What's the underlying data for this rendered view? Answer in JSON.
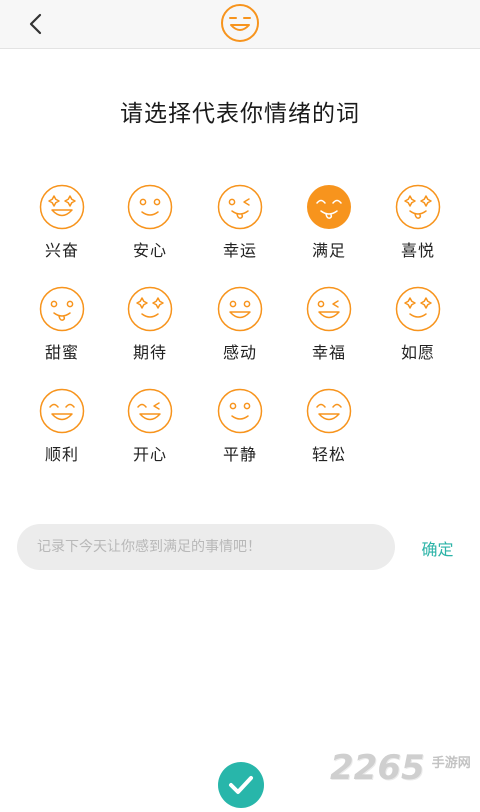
{
  "header": {
    "back_icon": "chevron-left-icon",
    "face_icon": "smile-face-icon"
  },
  "title": "请选择代表你情绪的词",
  "moods": [
    {
      "label": "兴奋",
      "icon": "star-eyes-face-icon",
      "selected": false
    },
    {
      "label": "安心",
      "icon": "calm-smile-face-icon",
      "selected": false
    },
    {
      "label": "幸运",
      "icon": "wink-tongue-face-icon",
      "selected": false
    },
    {
      "label": "满足",
      "icon": "content-tongue-face-icon",
      "selected": true
    },
    {
      "label": "喜悦",
      "icon": "star-eyes-tongue-face-icon",
      "selected": false
    },
    {
      "label": "甜蜜",
      "icon": "sweet-tongue-face-icon",
      "selected": false
    },
    {
      "label": "期待",
      "icon": "star-eyes-grin-face-icon",
      "selected": false
    },
    {
      "label": "感动",
      "icon": "moved-grin-face-icon",
      "selected": false
    },
    {
      "label": "幸福",
      "icon": "wink-grin-face-icon",
      "selected": false
    },
    {
      "label": "如愿",
      "icon": "star-eyes-smile-face-icon",
      "selected": false
    },
    {
      "label": "顺利",
      "icon": "happy-eyes-grin-face-icon",
      "selected": false
    },
    {
      "label": "开心",
      "icon": "wink-laugh-face-icon",
      "selected": false
    },
    {
      "label": "平静",
      "icon": "peaceful-smile-face-icon",
      "selected": false
    },
    {
      "label": "轻松",
      "icon": "relaxed-grin-face-icon",
      "selected": false
    }
  ],
  "note": {
    "value": "",
    "placeholder": "记录下今天让你感到满足的事情吧！"
  },
  "confirm_label": "确定",
  "submit_icon": "checkmark-icon",
  "watermark": {
    "number": "2265",
    "text": "手游网"
  },
  "colors": {
    "accent": "#F7941D",
    "teal": "#28B6AA",
    "input_bg": "#ECECEC"
  }
}
